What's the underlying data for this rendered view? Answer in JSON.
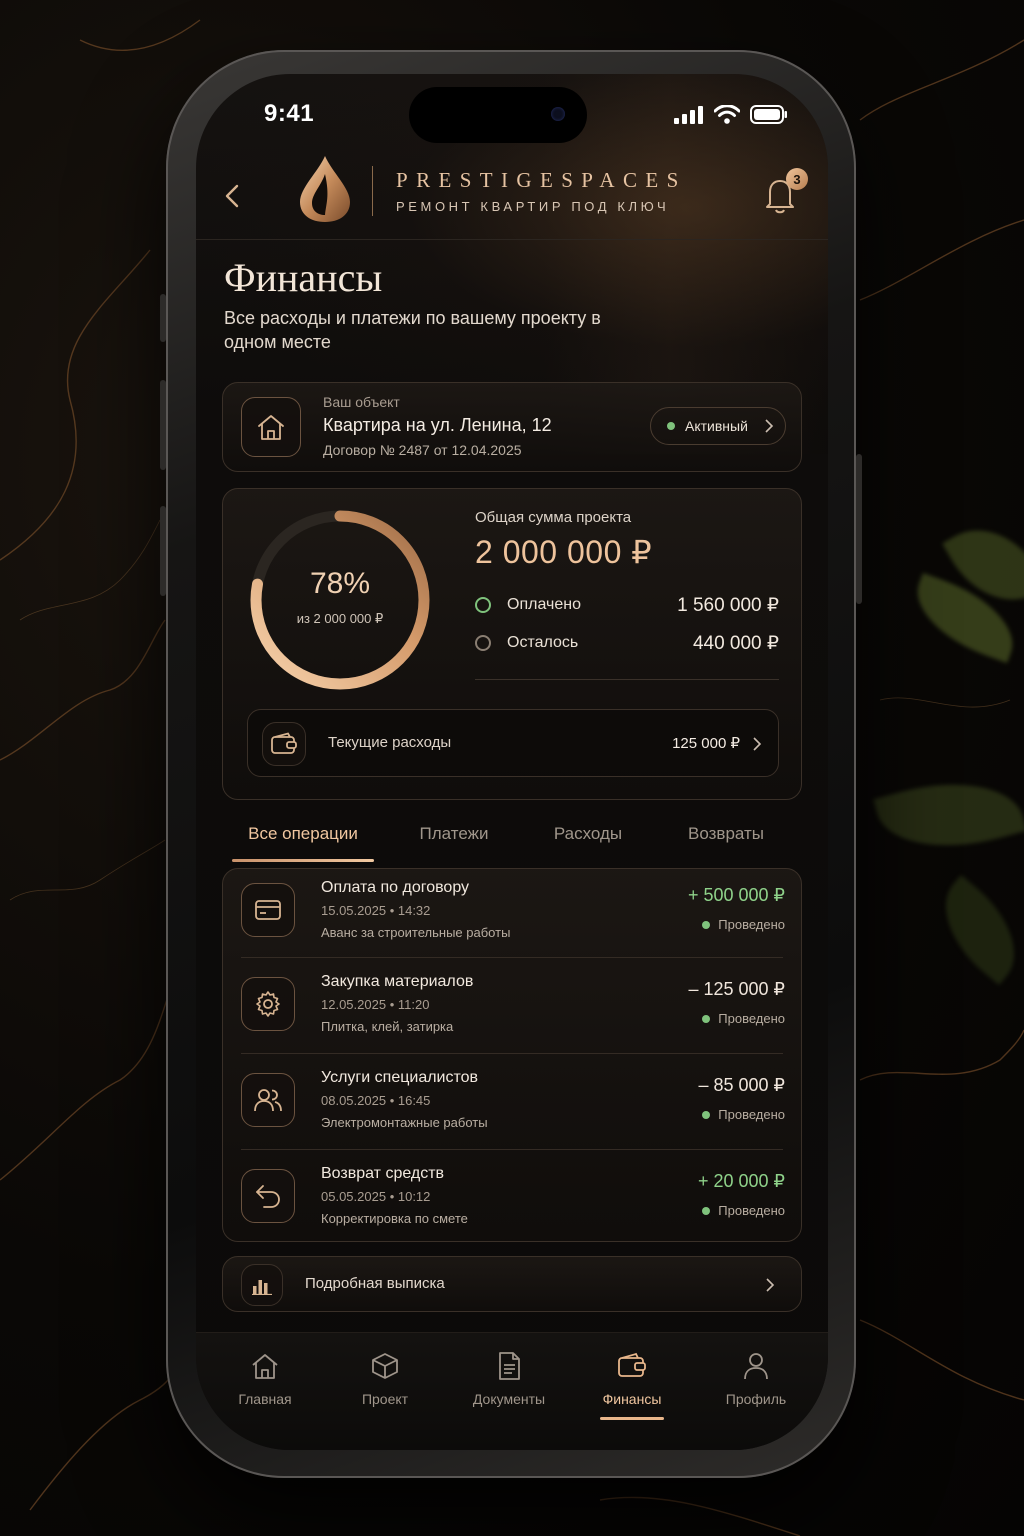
{
  "status_bar": {
    "time": "9:41"
  },
  "header": {
    "brand": "PRESTIGESPACES",
    "tagline": "РЕМОНТ КВАРТИР ПОД КЛЮЧ",
    "notification_count": "3"
  },
  "page": {
    "title": "Финансы",
    "subtitle": "Все расходы и платежи по вашему проекту в одном месте"
  },
  "object": {
    "label": "Ваш объект",
    "name": "Квартира на ул. Ленина, 12",
    "contract": "Договор № 2487 от 12.04.2025",
    "status": "Активный",
    "status_color": "#7fc27c"
  },
  "summary": {
    "percent_text": "78%",
    "percent_value": 0.78,
    "of_text": "из 2 000 000 ₽",
    "total_label": "Общая сумма проекта",
    "total": "2 000 000 ₽",
    "paid_label": "Оплачено",
    "paid": "1 560 000 ₽",
    "left_label": "Осталось",
    "left": "440 000 ₽",
    "expenses_label": "Текущие расходы",
    "expenses": "125 000 ₽"
  },
  "tabs": [
    "Все операции",
    "Платежи",
    "Расходы",
    "Возвраты"
  ],
  "operations": [
    {
      "title": "Оплата по договору",
      "date": "15.05.2025",
      "time": "14:32",
      "desc": "Аванс за строительные работы",
      "amount": "+ 500 000 ₽",
      "status": "Проведено",
      "icon": "card-icon"
    },
    {
      "title": "Закупка материалов",
      "date": "12.05.2025",
      "time": "11:20",
      "desc": "Плитка, клей, затирка",
      "amount": "– 125 000 ₽",
      "status": "Проведено",
      "icon": "gear-icon"
    },
    {
      "title": "Услуги специалистов",
      "date": "08.05.2025",
      "time": "16:45",
      "desc": "Электромонтажные работы",
      "amount": "– 85 000 ₽",
      "status": "Проведено",
      "icon": "users-icon"
    },
    {
      "title": "Возврат средств",
      "date": "05.05.2025",
      "time": "10:12",
      "desc": "Корректировка по смете",
      "amount": "+ 20 000 ₽",
      "status": "Проведено",
      "icon": "return-icon"
    }
  ],
  "statement": {
    "label": "Подробная выписка"
  },
  "nav": [
    "Главная",
    "Проект",
    "Документы",
    "Финансы",
    "Профиль"
  ],
  "colors": {
    "accent": "#e8b68b",
    "positive": "#8fd28a",
    "background": "#0b0a09"
  }
}
